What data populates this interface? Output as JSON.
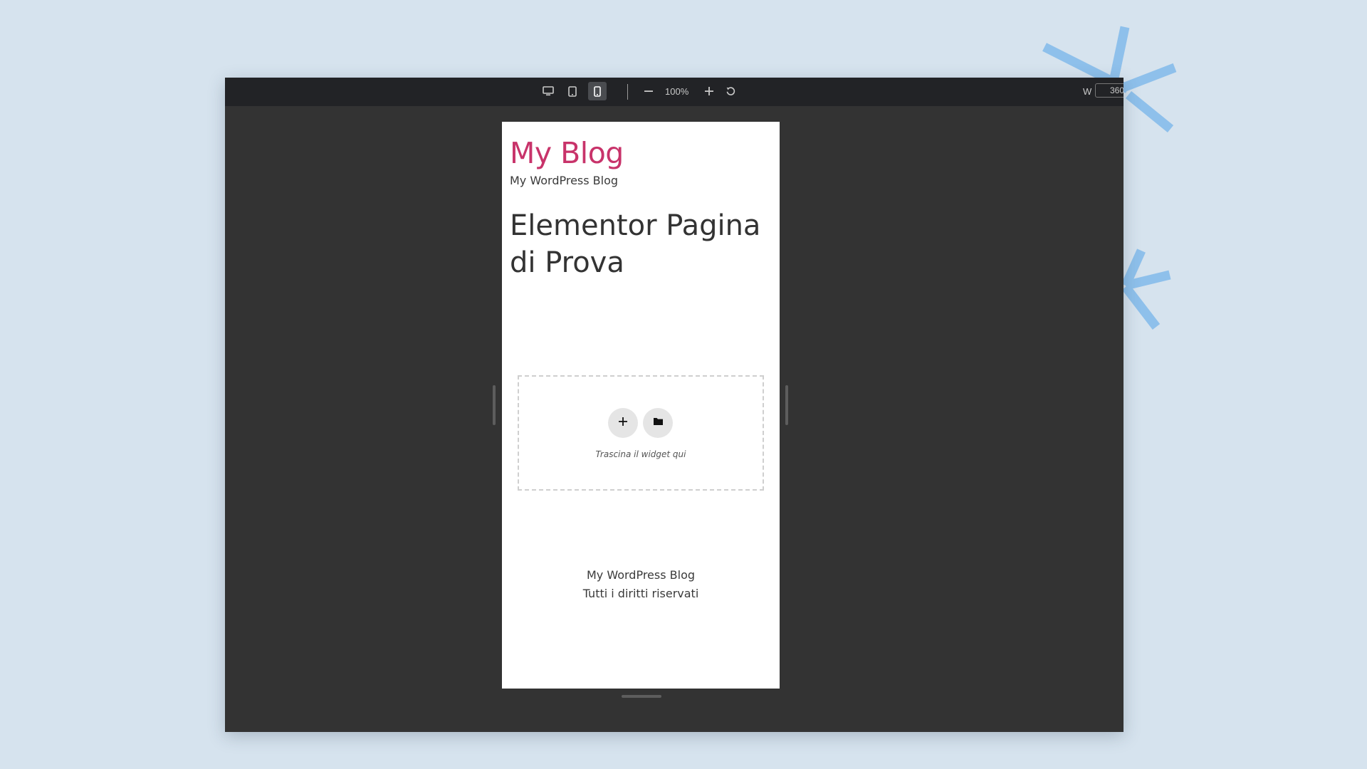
{
  "toolbar": {
    "devices": [
      {
        "name": "desktop",
        "icon": "desktop-icon",
        "active": false
      },
      {
        "name": "tablet",
        "icon": "tablet-icon",
        "active": false
      },
      {
        "name": "mobile",
        "icon": "mobile-icon",
        "active": true
      }
    ],
    "zoom_out_icon": "minus-icon",
    "zoom_level": "100%",
    "zoom_in_icon": "plus-icon",
    "reset_icon": "reset-icon",
    "width_label": "W",
    "width_value": "360"
  },
  "preview": {
    "site_title": "My Blog",
    "site_tagline": "My WordPress Blog",
    "page_title": "Elementor Pagina di Prova",
    "dropzone": {
      "add_icon": "plus-icon",
      "template_icon": "folder-icon",
      "hint": "Trascina il widget qui"
    },
    "footer": {
      "site_name": "My WordPress Blog",
      "rights": "Tutti i diritti riservati"
    }
  },
  "colors": {
    "background": "#d6e3ee",
    "toolbar": "#222326",
    "canvas": "#333333",
    "site_title": "#c8336a",
    "decoration": "#8ec0eb"
  }
}
